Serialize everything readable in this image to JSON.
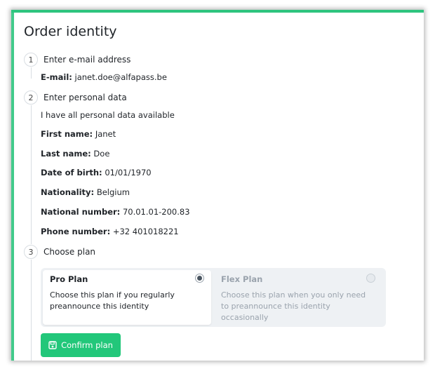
{
  "page": {
    "title": "Order identity"
  },
  "steps": [
    {
      "number": "1",
      "label": "Enter e-mail address"
    },
    {
      "number": "2",
      "label": "Enter personal data"
    },
    {
      "number": "3",
      "label": "Choose plan"
    }
  ],
  "email": {
    "label": "E-mail:",
    "value": "janet.doe@alfapass.be"
  },
  "personal": {
    "intro": "I have all personal data available",
    "fields": [
      {
        "label": "First name:",
        "value": "Janet"
      },
      {
        "label": "Last name:",
        "value": "Doe"
      },
      {
        "label": "Date of birth:",
        "value": "01/01/1970"
      },
      {
        "label": "Nationality:",
        "value": "Belgium"
      },
      {
        "label": "National number:",
        "value": "70.01.01-200.83"
      },
      {
        "label": "Phone number:",
        "value": "+32 401018221"
      }
    ]
  },
  "plans": [
    {
      "name": "Pro Plan",
      "description_line1": "Choose this plan if you regularly",
      "description_line2": "preannounce this identity",
      "selected": true
    },
    {
      "name": "Flex Plan",
      "description_line1": "Choose this plan when you only need",
      "description_line2": "to preannounce this identity",
      "description_line3": "occasionally",
      "selected": false
    }
  ],
  "confirm_button": {
    "label": "Confirm plan",
    "icon": "save-icon"
  },
  "colors": {
    "accent": "#22c77a",
    "muted": "#9aa3ad"
  }
}
